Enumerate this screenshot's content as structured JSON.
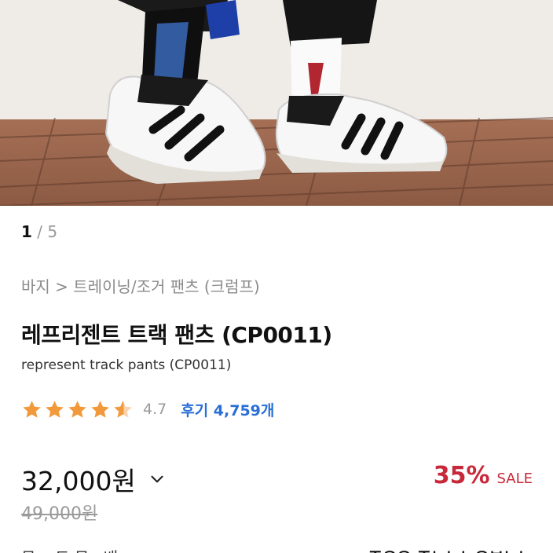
{
  "gallery": {
    "current": "1",
    "separator": " / ",
    "total": "5"
  },
  "breadcrumb": "바지 > 트레이닝/조거 팬츠 (크럼프)",
  "product": {
    "title": "레프리젠트 트랙 팬츠 (CP0011)",
    "subtitle": "represent track pants (CP0011)"
  },
  "rating": {
    "value": "4.7",
    "stars": 4.5,
    "reviews_label": "후기 4,759개"
  },
  "price": {
    "current": "32,000원",
    "original": "49,000원",
    "discount": "35%",
    "sale_label": "SALE"
  },
  "footer_partial": {
    "left": "뮤 ㅅ트 뮤ㅁ배ㅅ",
    "right": "ᄌᄋᄋ ᄌᄂᄂᄂᄋᄇᄂᄂ"
  },
  "colors": {
    "star": "#f29a3b",
    "discount": "#c8293a",
    "review": "#2a6fd6"
  },
  "icons": {
    "price_toggle": "chevron-down-icon",
    "star": "star-icon"
  }
}
